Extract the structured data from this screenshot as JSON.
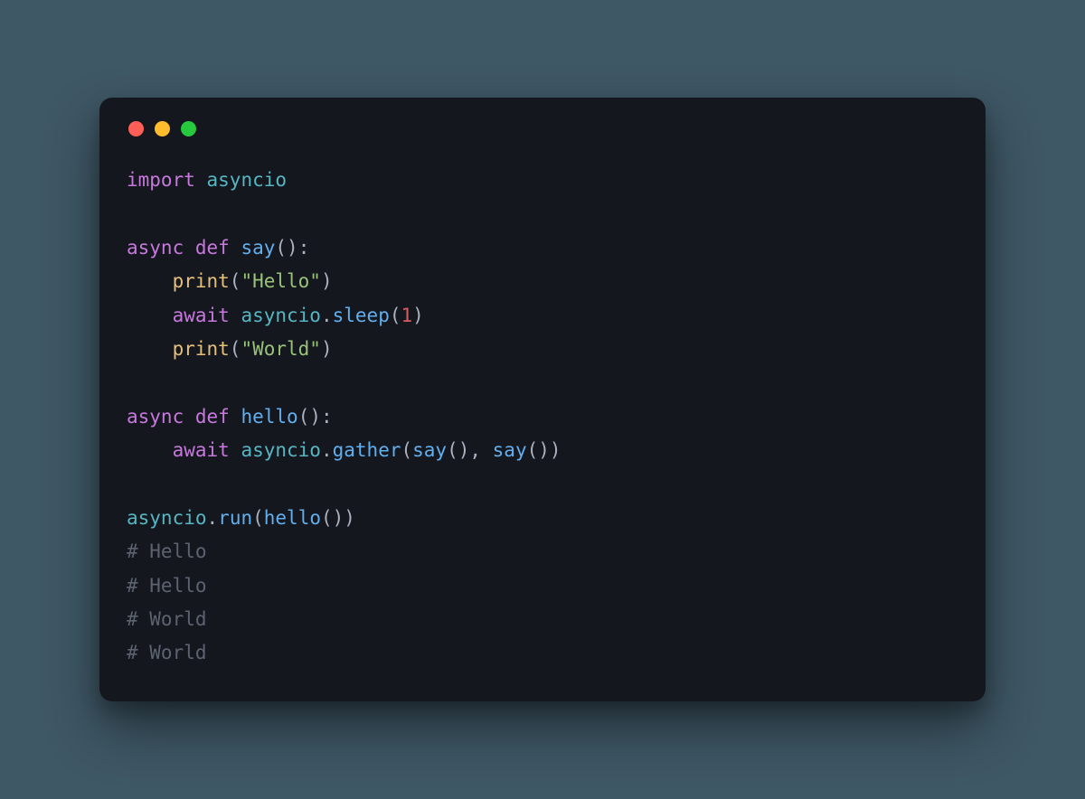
{
  "window": {
    "traffic_lights": {
      "red": "#ff5f56",
      "yellow": "#ffbd2e",
      "green": "#27c93f"
    }
  },
  "code": {
    "lines": [
      [
        {
          "cls": "tk-kw",
          "text": "import"
        },
        {
          "cls": "tk-default",
          "text": " "
        },
        {
          "cls": "tk-mod",
          "text": "asyncio"
        }
      ],
      [],
      [
        {
          "cls": "tk-kw",
          "text": "async"
        },
        {
          "cls": "tk-default",
          "text": " "
        },
        {
          "cls": "tk-kw",
          "text": "def"
        },
        {
          "cls": "tk-default",
          "text": " "
        },
        {
          "cls": "tk-fn",
          "text": "say"
        },
        {
          "cls": "tk-punc",
          "text": "():"
        }
      ],
      [
        {
          "cls": "tk-default",
          "text": "    "
        },
        {
          "cls": "tk-builtin",
          "text": "print"
        },
        {
          "cls": "tk-punc",
          "text": "("
        },
        {
          "cls": "tk-str",
          "text": "\"Hello\""
        },
        {
          "cls": "tk-punc",
          "text": ")"
        }
      ],
      [
        {
          "cls": "tk-default",
          "text": "    "
        },
        {
          "cls": "tk-kw",
          "text": "await"
        },
        {
          "cls": "tk-default",
          "text": " "
        },
        {
          "cls": "tk-mod",
          "text": "asyncio"
        },
        {
          "cls": "tk-punc",
          "text": "."
        },
        {
          "cls": "tk-fn",
          "text": "sleep"
        },
        {
          "cls": "tk-punc",
          "text": "("
        },
        {
          "cls": "tk-num",
          "text": "1"
        },
        {
          "cls": "tk-punc",
          "text": ")"
        }
      ],
      [
        {
          "cls": "tk-default",
          "text": "    "
        },
        {
          "cls": "tk-builtin",
          "text": "print"
        },
        {
          "cls": "tk-punc",
          "text": "("
        },
        {
          "cls": "tk-str",
          "text": "\"World\""
        },
        {
          "cls": "tk-punc",
          "text": ")"
        }
      ],
      [],
      [
        {
          "cls": "tk-kw",
          "text": "async"
        },
        {
          "cls": "tk-default",
          "text": " "
        },
        {
          "cls": "tk-kw",
          "text": "def"
        },
        {
          "cls": "tk-default",
          "text": " "
        },
        {
          "cls": "tk-fn",
          "text": "hello"
        },
        {
          "cls": "tk-punc",
          "text": "():"
        }
      ],
      [
        {
          "cls": "tk-default",
          "text": "    "
        },
        {
          "cls": "tk-kw",
          "text": "await"
        },
        {
          "cls": "tk-default",
          "text": " "
        },
        {
          "cls": "tk-mod",
          "text": "asyncio"
        },
        {
          "cls": "tk-punc",
          "text": "."
        },
        {
          "cls": "tk-fn",
          "text": "gather"
        },
        {
          "cls": "tk-punc",
          "text": "("
        },
        {
          "cls": "tk-fn",
          "text": "say"
        },
        {
          "cls": "tk-punc",
          "text": "(), "
        },
        {
          "cls": "tk-fn",
          "text": "say"
        },
        {
          "cls": "tk-punc",
          "text": "())"
        }
      ],
      [],
      [
        {
          "cls": "tk-mod",
          "text": "asyncio"
        },
        {
          "cls": "tk-punc",
          "text": "."
        },
        {
          "cls": "tk-fn",
          "text": "run"
        },
        {
          "cls": "tk-punc",
          "text": "("
        },
        {
          "cls": "tk-fn",
          "text": "hello"
        },
        {
          "cls": "tk-punc",
          "text": "())"
        }
      ],
      [
        {
          "cls": "tk-comment",
          "text": "# Hello"
        }
      ],
      [
        {
          "cls": "tk-comment",
          "text": "# Hello"
        }
      ],
      [
        {
          "cls": "tk-comment",
          "text": "# World"
        }
      ],
      [
        {
          "cls": "tk-comment",
          "text": "# World"
        }
      ]
    ]
  }
}
